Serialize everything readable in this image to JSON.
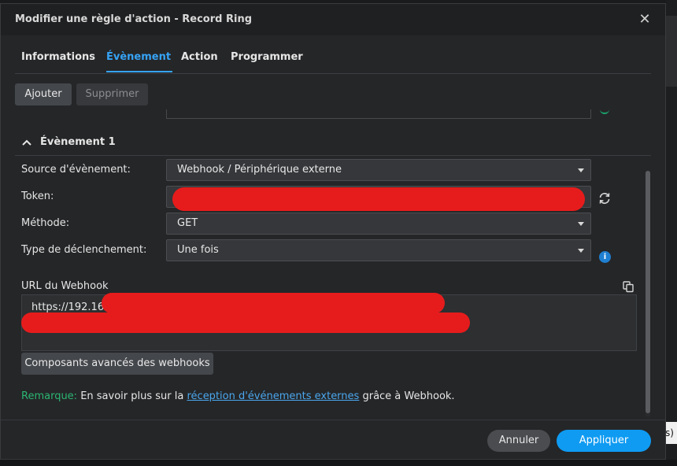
{
  "dialog": {
    "title": "Modifier une règle d'action - Record Ring",
    "close_icon": "close-icon"
  },
  "tabs": [
    {
      "label": "Informations",
      "active": false
    },
    {
      "label": "Évènement",
      "active": true
    },
    {
      "label": "Action",
      "active": false
    },
    {
      "label": "Programmer",
      "active": false
    }
  ],
  "toolbar": {
    "add_label": "Ajouter",
    "delete_label": "Supprimer"
  },
  "section": {
    "title": "Évènement 1"
  },
  "form": {
    "source": {
      "label": "Source d'évènement:",
      "value": "Webhook / Périphérique externe"
    },
    "token": {
      "label": "Token:",
      "value": ""
    },
    "method": {
      "label": "Méthode:",
      "value": "GET"
    },
    "trigger": {
      "label": "Type de déclenchement:",
      "value": "Une fois"
    }
  },
  "webhook": {
    "label": "URL du Webhook",
    "url_prefix": "https://192.168"
  },
  "advanced_label": "Composants avancés des webhooks",
  "note": {
    "label": "Remarque:",
    "text_before": "En savoir plus sur la",
    "link": "réception d'événements externes",
    "text_after": "grâce à Webhook."
  },
  "footer": {
    "cancel_label": "Annuler",
    "apply_label": "Appliquer"
  },
  "background": {
    "chip_text": "s)"
  },
  "colors": {
    "accent": "#36a3f5",
    "apply": "#0f9bf2",
    "note_label": "#2bb673",
    "redaction": "#e61c1c"
  }
}
